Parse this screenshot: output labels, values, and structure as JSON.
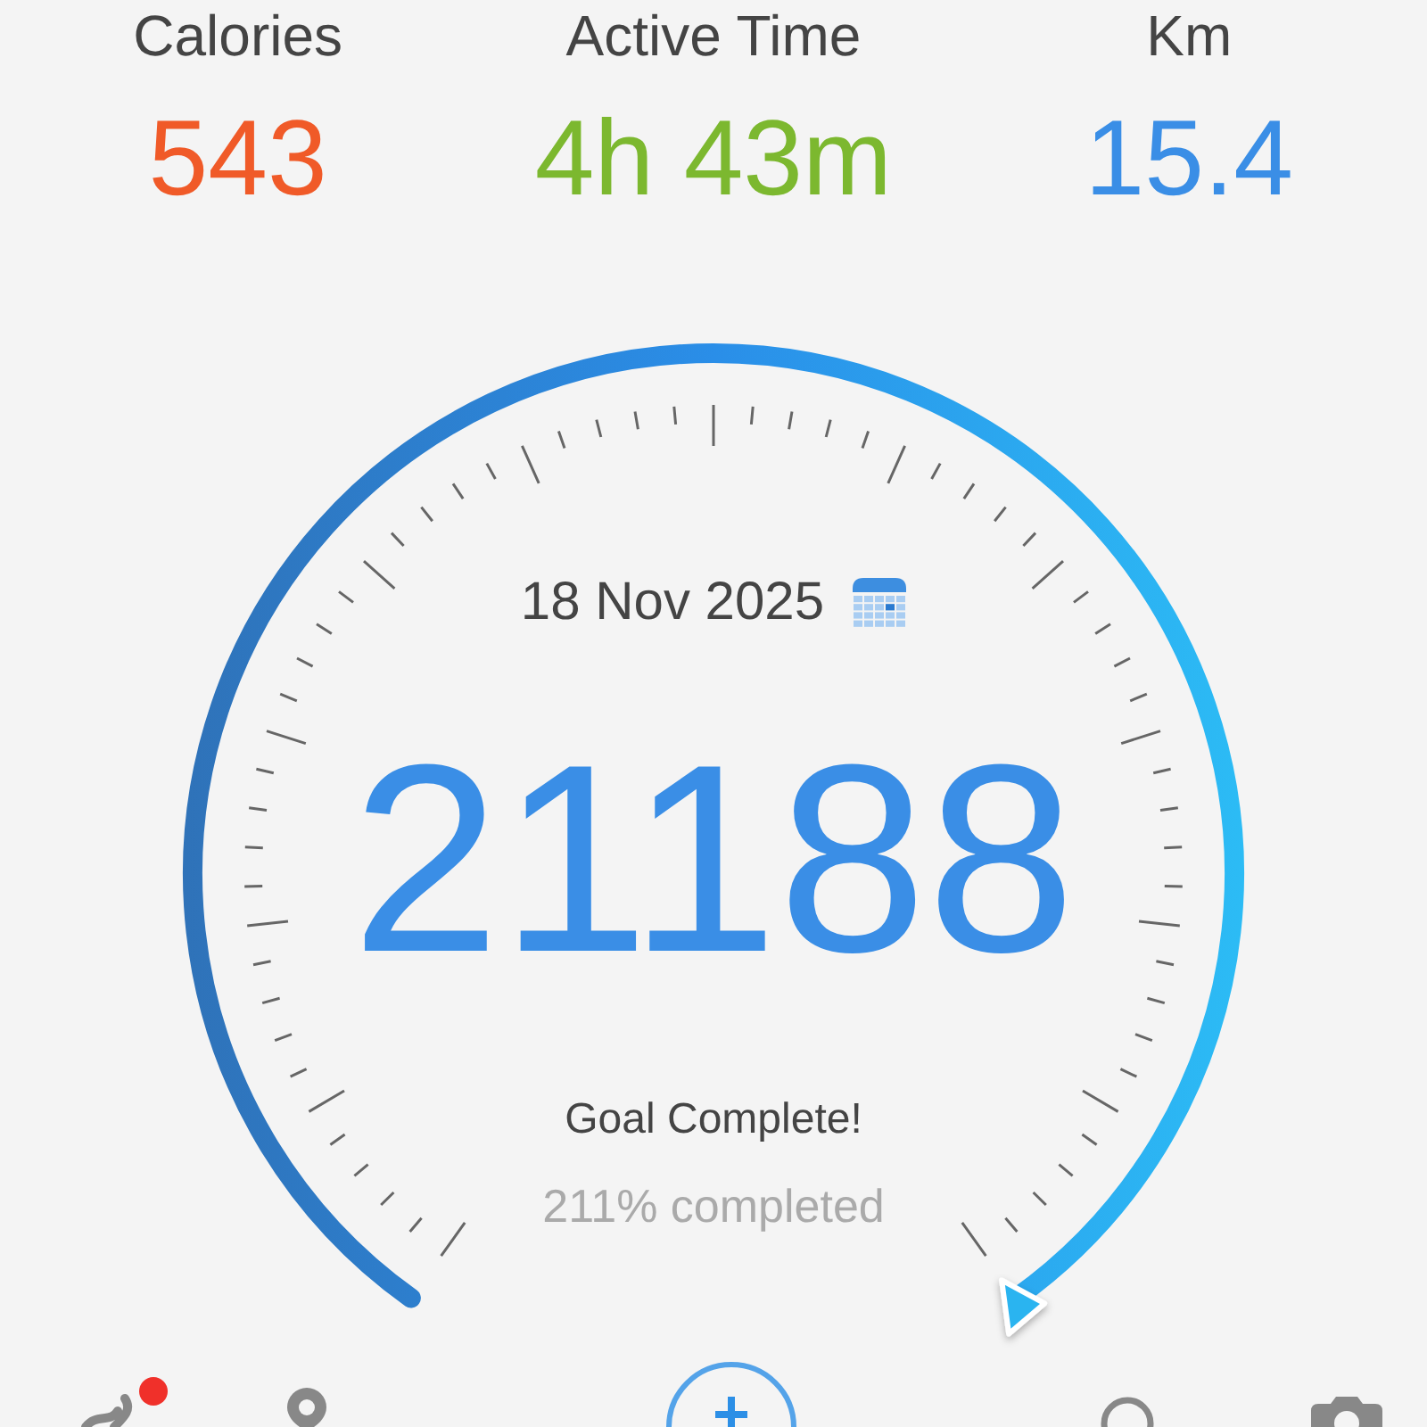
{
  "stats": [
    {
      "label": "Calories",
      "value": "543",
      "color": "#f05a28"
    },
    {
      "label": "Active Time",
      "value": "4h 43m",
      "color": "#7cb82f"
    },
    {
      "label": "Km",
      "value": "15.4",
      "color": "#3a8ee6"
    }
  ],
  "dial": {
    "date": "18 Nov 2025",
    "steps": "21188",
    "status": "Goal Complete!",
    "percent": "211% completed"
  },
  "nav": [
    {
      "kind": "activity",
      "badge": true
    },
    {
      "kind": "location"
    },
    {
      "kind": "add"
    },
    {
      "kind": "search"
    },
    {
      "kind": "camera"
    }
  ]
}
